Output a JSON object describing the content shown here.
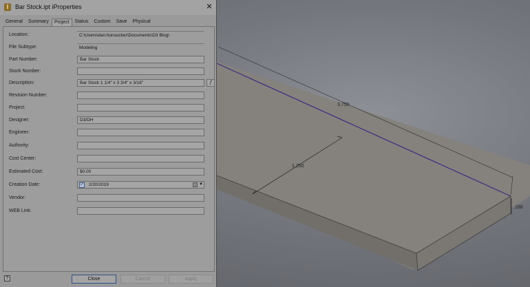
{
  "window": {
    "title": "Bar Stock.ipt iProperties",
    "app_icon_letter": "I",
    "close_glyph": "✕"
  },
  "tabs": [
    {
      "label": "General",
      "active": false
    },
    {
      "label": "Summary",
      "active": false
    },
    {
      "label": "Project",
      "active": true
    },
    {
      "label": "Status",
      "active": false
    },
    {
      "label": "Custom",
      "active": false
    },
    {
      "label": "Save",
      "active": false
    },
    {
      "label": "Physical",
      "active": false
    }
  ],
  "fields": {
    "location": {
      "label": "Location:",
      "value": "C:\\Users\\dan.hunsucker\\Documents\\D3 Blog\\"
    },
    "file_subtype": {
      "label": "File Subtype:",
      "value": "Modeling"
    },
    "part_number": {
      "label": "Part Number:",
      "value": "Bar Stock"
    },
    "stock_number": {
      "label": "Stock Number:",
      "value": ""
    },
    "description": {
      "label": "Description:",
      "value": "Bar Stock 1 1/4\" x 3 3/4\" x 3/16\""
    },
    "revision_number": {
      "label": "Revision Number:",
      "value": ""
    },
    "project": {
      "label": "Project:",
      "value": ""
    },
    "designer": {
      "label": "Designer:",
      "value": "D3/DH"
    },
    "engineer": {
      "label": "Engineer:",
      "value": ""
    },
    "authority": {
      "label": "Authority:",
      "value": ""
    },
    "cost_center": {
      "label": "Cost Center:",
      "value": ""
    },
    "estimated_cost": {
      "label": "Estimated Cost:",
      "value": "$0.00"
    },
    "creation_date": {
      "label": "Creation Date:",
      "value": "2/20/2019",
      "checked": true
    },
    "vendor": {
      "label": "Vendor:",
      "value": ""
    },
    "web_link": {
      "label": "WEB Link:",
      "value": ""
    }
  },
  "fx_label": "f",
  "buttons": {
    "help": "?",
    "close": "Close",
    "cancel": "Cancel",
    "apply": "Apply"
  },
  "viewport": {
    "dimension_length": "3.750",
    "dimension_width": "1.250",
    "dimension_thickness": ".188"
  }
}
